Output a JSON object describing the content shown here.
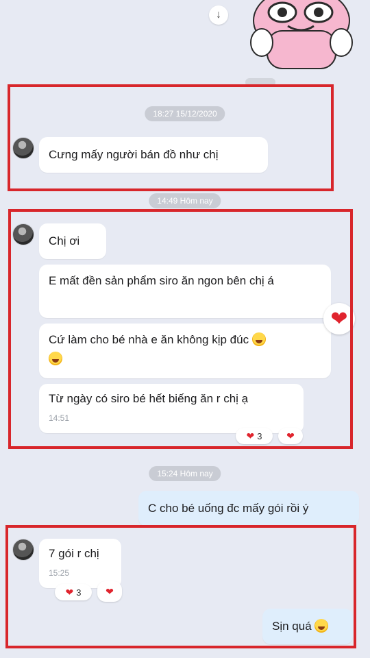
{
  "top": {
    "download_icon": "↓"
  },
  "timestamps": [
    "18:27 15/12/2020",
    "14:49 Hôm nay",
    "15:24 Hôm nay"
  ],
  "messages": [
    {
      "text": "Cưng mấy người bán đồ như chị"
    },
    {
      "text": "Chị ơi"
    },
    {
      "text": "E mất đền sản phẩm siro ăn ngon bên chị á"
    },
    {
      "text": "Cứ làm cho bé nhà e ăn không kịp đúc"
    },
    {
      "text": "Từ ngày có siro bé hết biếng ăn r chị ạ",
      "time": "14:51"
    },
    {
      "text": "C cho bé uống đc mấy gói rồi ý"
    },
    {
      "text": "7 gói r chị",
      "time": "15:25"
    },
    {
      "text": "Sịn quá"
    }
  ],
  "reactions": {
    "group2_count": "3",
    "group3_count": "3"
  },
  "colors": {
    "highlight_box": "#d8262b",
    "sent_bubble": "#dfeefc",
    "background": "#e7eaf3"
  }
}
